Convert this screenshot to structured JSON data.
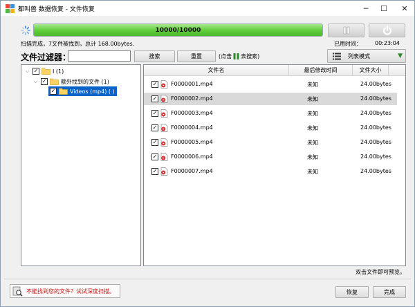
{
  "window": {
    "title": "都叫兽 数据恢复 - 文件恢复",
    "controls": {
      "minimize": "─",
      "maximize": "☐",
      "close": "✕"
    }
  },
  "scan": {
    "progress_label": "10000/10000",
    "progress_fraction": 1.0,
    "progress_color": "#5fcc3a",
    "status": "扫描完成，7文件被找到，总计 168.00bytes.",
    "elapsed_label": "已用时间：",
    "elapsed_value": "00:23:04"
  },
  "filter": {
    "label": "文件过滤器：",
    "input_value": "",
    "search_label": "搜索",
    "reset_label": "重置",
    "hint_prefix": "(点击",
    "hint_suffix": "去搜索)",
    "view_mode_label": "列表模式"
  },
  "tree": {
    "root": {
      "label": "I (1)",
      "checked": true
    },
    "child": {
      "label": "额外找到的文件 (1)",
      "checked": true
    },
    "leaf": {
      "label": "Videos (mp4) ( )",
      "checked": true,
      "selected": true
    }
  },
  "columns": {
    "name": "文件名",
    "modified": "最后修改时间",
    "size": "文件大小"
  },
  "files": [
    {
      "name": "F0000001.mp4",
      "modified": "未知",
      "size": "24.00bytes",
      "checked": true,
      "highlighted": false
    },
    {
      "name": "F0000002.mp4",
      "modified": "未知",
      "size": "24.00bytes",
      "checked": true,
      "highlighted": true
    },
    {
      "name": "F0000003.mp4",
      "modified": "未知",
      "size": "24.00bytes",
      "checked": true,
      "highlighted": false
    },
    {
      "name": "F0000004.mp4",
      "modified": "未知",
      "size": "24.00bytes",
      "checked": true,
      "highlighted": false
    },
    {
      "name": "F0000005.mp4",
      "modified": "未知",
      "size": "24.00bytes",
      "checked": true,
      "highlighted": false
    },
    {
      "name": "F0000006.mp4",
      "modified": "未知",
      "size": "24.00bytes",
      "checked": true,
      "highlighted": false
    },
    {
      "name": "F0000007.mp4",
      "modified": "未知",
      "size": "24.00bytes",
      "checked": true,
      "highlighted": false
    }
  ],
  "footer": {
    "preview_hint": "双击文件即可预览。",
    "deep_scan_label": "不能找到您的文件？试试深度扫描。",
    "recover_label": "恢复",
    "finish_label": "完成"
  },
  "icons": {
    "app": "app-logo-icon",
    "spinner": "loading-spinner-icon",
    "pause": "pause-icon",
    "stop": "stop-icon",
    "filter_hint": "green-bars-icon",
    "view_mode": "list-icon",
    "view_caret": "caret-down-icon",
    "folder": "folder-icon",
    "file": "video-file-icon",
    "deep_scan": "deep-scan-icon"
  },
  "colors": {
    "selection": "#0a63c9",
    "row_highlight": "#d9d9d9",
    "deep_scan_text": "#d01010",
    "accent_green": "#2c8a2c"
  }
}
